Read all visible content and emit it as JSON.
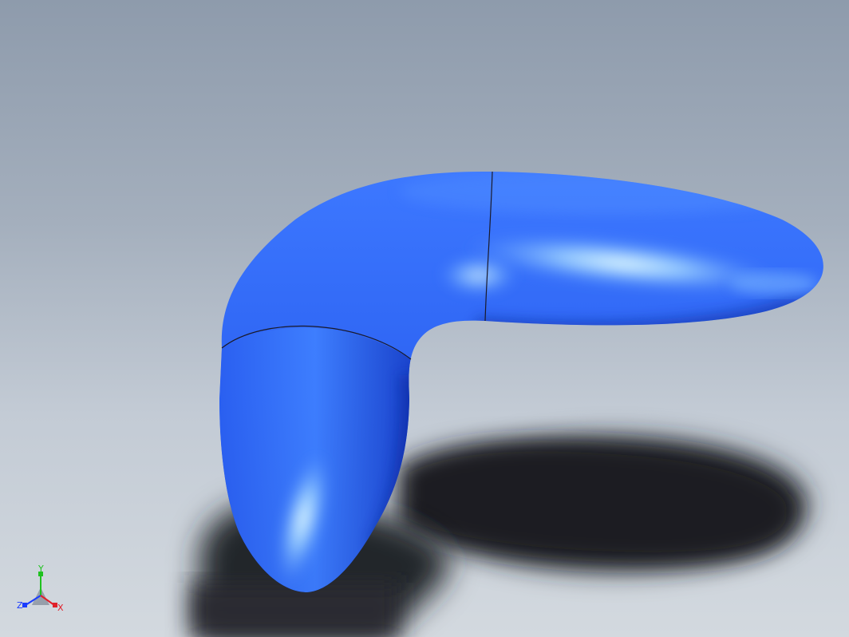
{
  "viewport": {
    "background_top": "#8e9bac",
    "background_bottom": "#d3d9df"
  },
  "model": {
    "part_color": "#2f64f0",
    "highlight_color": "#cfeeff",
    "edge_color": "#1a1a2a"
  },
  "triad": {
    "y_label": "Y",
    "z_label": "Z",
    "x_label": "X",
    "y_color": "#1fc21f",
    "z_color": "#1a3cff",
    "x_color": "#e0202a"
  }
}
